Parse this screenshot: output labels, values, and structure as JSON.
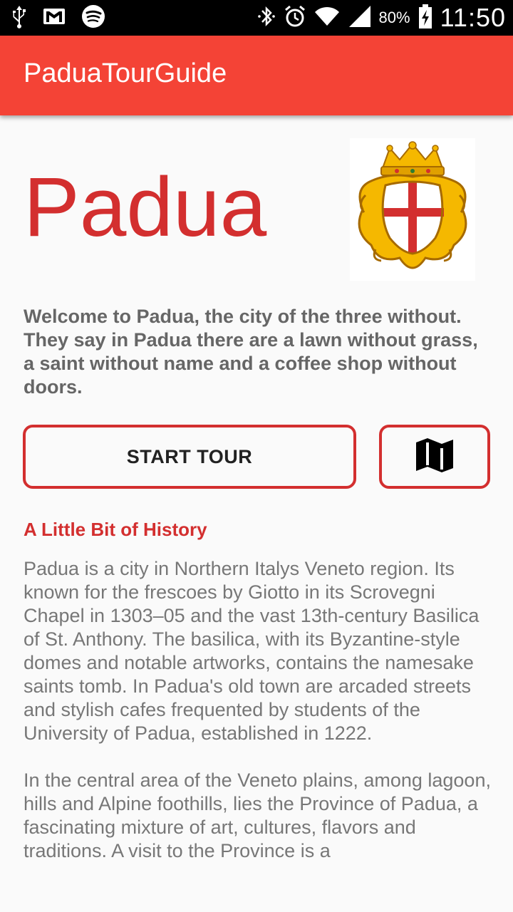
{
  "status_bar": {
    "battery": "80%",
    "time": "11:50",
    "icons": [
      "usb-icon",
      "gmail-icon",
      "spotify-icon",
      "bluetooth-icon",
      "alarm-icon",
      "wifi-icon",
      "signal-icon",
      "battery-icon"
    ]
  },
  "app_bar": {
    "title": "PaduaTourGuide",
    "color": "#f44336"
  },
  "header": {
    "city_name": "Padua",
    "crest_icon": "padua-coat-of-arms-icon"
  },
  "intro_text": "Welcome to Padua, the city of the three without. They say in Padua there are a lawn without grass, a saint without name and a coffee shop without doors.",
  "buttons": {
    "start_tour": "START TOUR",
    "map_icon": "map-icon"
  },
  "history": {
    "title": "A Little Bit of History",
    "paragraphs": [
      "Padua is a city in Northern Italys Veneto region. Its known for the frescoes by Giotto in its Scrovegni Chapel in 1303–05 and the vast 13th-century Basilica of St. Anthony. The basilica, with its Byzantine-style domes and notable artworks, contains the namesake saints tomb. In Padua's old town are arcaded streets and stylish cafes frequented by students of the University of Padua, established in 1222.",
      "In the central area of the Veneto plains, among lagoon, hills and Alpine foothills, lies the Province of Padua, a fascinating mixture of art, cultures, flavors and traditions. A visit to the Province is a"
    ]
  },
  "colors": {
    "accent": "#d32f2f",
    "appbar": "#f44336",
    "text_gray": "#777777"
  }
}
